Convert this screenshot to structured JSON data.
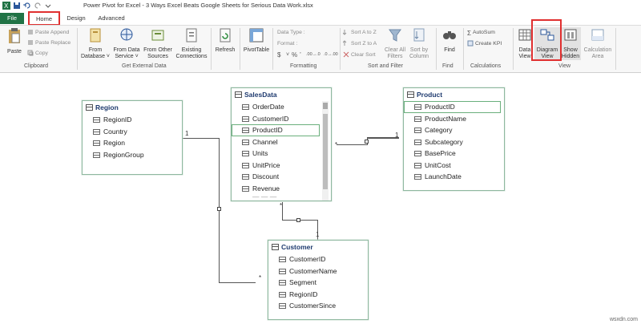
{
  "app": {
    "title": "Power Pivot for Excel - 3 Ways Excel Beats Google Sheets for Serious Data Work.xlsx"
  },
  "tabs": {
    "file": "File",
    "home": "Home",
    "design": "Design",
    "advanced": "Advanced"
  },
  "ribbon": {
    "clipboard": {
      "paste": "Paste",
      "paste_append": "Paste Append",
      "paste_replace": "Paste Replace",
      "copy": "Copy",
      "group": "Clipboard"
    },
    "external": {
      "from_database": [
        "From",
        "Database ˅"
      ],
      "from_data_service": [
        "From Data",
        "Service ˅"
      ],
      "from_other_sources": [
        "From Other",
        "Sources"
      ],
      "existing_connections": [
        "Existing",
        "Connections"
      ],
      "group": "Get External Data"
    },
    "refresh": "Refresh",
    "pivottable": "PivotTable",
    "formatting": {
      "data_type": "Data Type :",
      "format": "Format :",
      "currency": "$",
      "percent": "%",
      "comma": "’",
      "decimals_up": ".00→.0",
      "decimals_down": ".0→.00",
      "group": "Formatting"
    },
    "sort": {
      "sort_az": "Sort A to Z",
      "sort_za": "Sort Z to A",
      "clear_sort": "Clear Sort",
      "clear_all_filters": [
        "Clear All",
        "Filters"
      ],
      "sort_by_column": [
        "Sort by",
        "Column"
      ],
      "group": "Sort and Filter"
    },
    "find": {
      "find": "Find",
      "group": "Find"
    },
    "calculations": {
      "autosum": "AutoSum",
      "create_kpi": "Create KPI",
      "group": "Calculations"
    },
    "view": {
      "data_view": [
        "Data",
        "View"
      ],
      "diagram_view": [
        "Diagram",
        "View"
      ],
      "show_hidden": [
        "Show",
        "Hidden"
      ],
      "calculation_area": [
        "Calculation",
        "Area"
      ],
      "group": "View"
    }
  },
  "diagram": {
    "region": {
      "name": "Region",
      "fields": [
        "RegionID",
        "Country",
        "Region",
        "RegionGroup"
      ]
    },
    "salesdata": {
      "name": "SalesData",
      "fields": [
        "OrderDate",
        "CustomerID",
        "ProductID",
        "Channel",
        "Units",
        "UnitPrice",
        "Discount",
        "Revenue",
        "— — —"
      ]
    },
    "product": {
      "name": "Product",
      "fields": [
        "ProductID",
        "ProductName",
        "Category",
        "Subcategory",
        "BasePrice",
        "UnitCost",
        "LaunchDate"
      ]
    },
    "customer": {
      "name": "Customer",
      "fields": [
        "CustomerID",
        "CustomerName",
        "Segment",
        "RegionID",
        "CustomerSince"
      ]
    },
    "relationship_labels": {
      "one": "1",
      "many": "*"
    }
  },
  "watermark": "wsxdn.com",
  "colors": {
    "accent_green": "#217346",
    "highlight_red": "#e03030",
    "table_border": "#8fb8a0",
    "title_text": "#1f3b6f"
  }
}
